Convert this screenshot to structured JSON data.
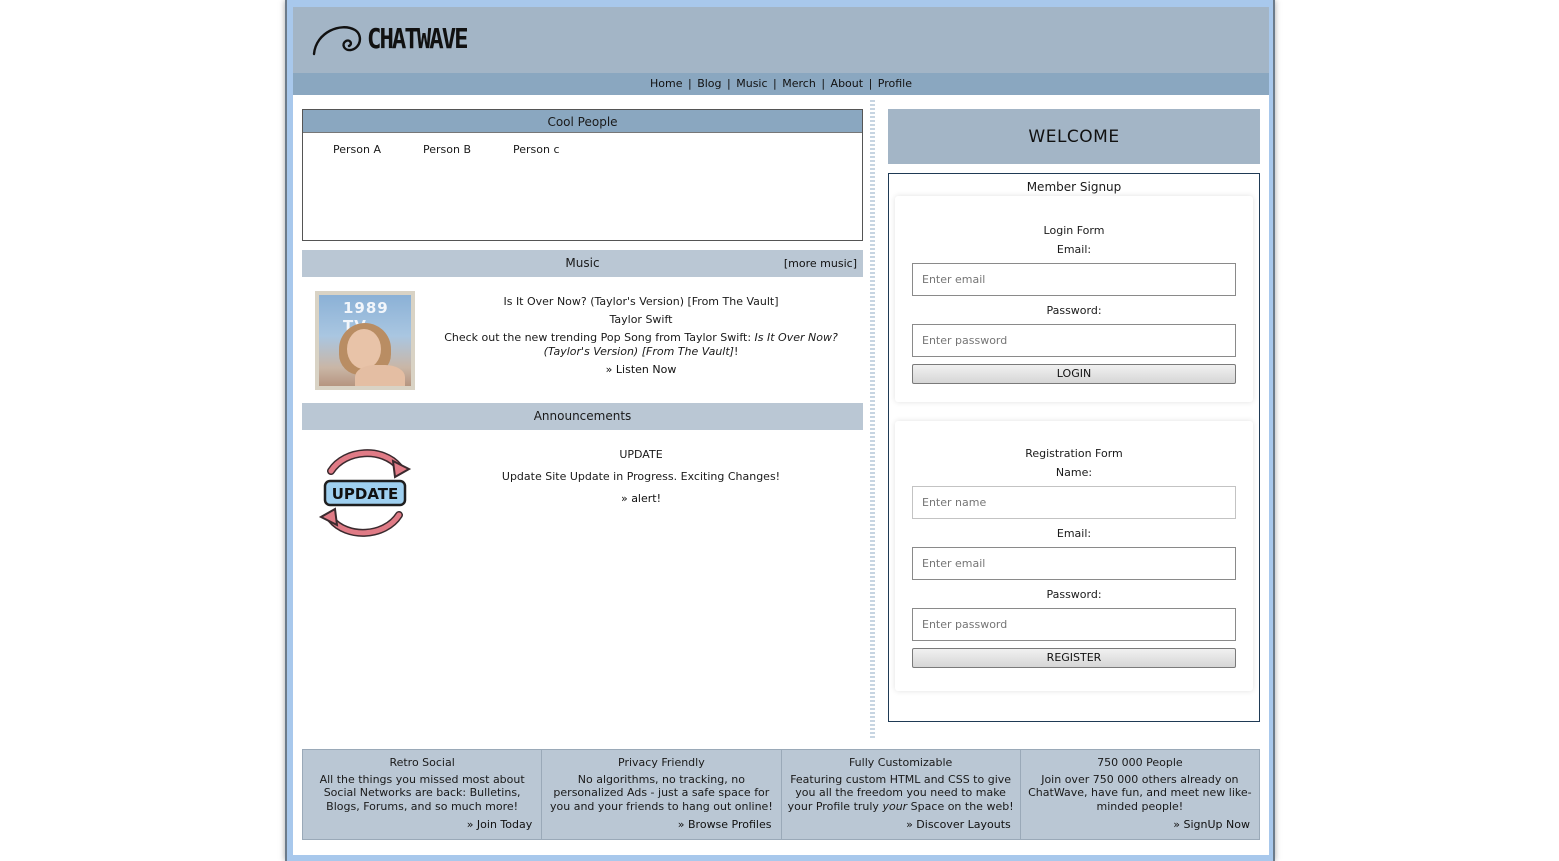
{
  "header": {
    "logo_text": "CHATWAVE"
  },
  "nav": {
    "items": [
      "Home",
      "Blog",
      "Music",
      "Merch",
      "About",
      "Profile"
    ],
    "separator": "|"
  },
  "cool_people": {
    "title": "Cool People",
    "people": [
      "Person A",
      "Person B",
      "Person c"
    ]
  },
  "music": {
    "title": "Music",
    "more_link": "[more music]",
    "album_art_text": "1989 TV",
    "song_title": "Is It Over Now? (Taylor's Version) [From The Vault]",
    "artist": "Taylor Swift",
    "description_prefix": "Check out the new trending Pop Song from Taylor Swift: ",
    "description_song": "Is It Over Now? (Taylor's Version) [From The Vault]",
    "description_suffix": "!",
    "listen_link": "» Listen Now"
  },
  "announcements": {
    "title": "Announcements",
    "icon_label": "UPDATE",
    "heading": "UPDATE",
    "text": "Update Site Update in Progress. Exciting Changes!",
    "link": "» alert!"
  },
  "welcome": {
    "title": "WELCOME"
  },
  "signup": {
    "title": "Member Signup",
    "login": {
      "title": "Login Form",
      "email_label": "Email:",
      "email_placeholder": "Enter email",
      "password_label": "Password:",
      "password_placeholder": "Enter password",
      "button": "LOGIN"
    },
    "register": {
      "title": "Registration Form",
      "name_label": "Name:",
      "name_placeholder": "Enter name",
      "email_label": "Email:",
      "email_placeholder": "Enter email",
      "password_label": "Password:",
      "password_placeholder": "Enter password",
      "button": "REGISTER"
    }
  },
  "footer": [
    {
      "title": "Retro Social",
      "text": "All the things you missed most about Social Networks are back: Bulletins, Blogs, Forums, and so much more!",
      "link": "» Join Today"
    },
    {
      "title": "Privacy Friendly",
      "text": "No algorithms, no tracking, no personalized Ads - just a safe space for you and your friends to hang out online!",
      "link": "» Browse Profiles"
    },
    {
      "title": "Fully Customizable",
      "text_prefix": "Featuring custom HTML and CSS to give you all the freedom you need to make your Profile truly ",
      "text_em": "your",
      "text_suffix": " Space on the web!",
      "link": "» Discover Layouts"
    },
    {
      "title": "750 000 People",
      "text": "Join over 750 000 others already on ChatWave, have fun, and meet new like-minded people!",
      "link": "» SignUp Now"
    }
  ],
  "colors": {
    "header_bg": "#a3b5c6",
    "nav_bg": "#8aa7c0",
    "section_bar_bg": "#bac7d4",
    "frame_bg": "#a8c8ec",
    "update_red": "#e07b86",
    "update_blue": "#9fd0f0"
  }
}
